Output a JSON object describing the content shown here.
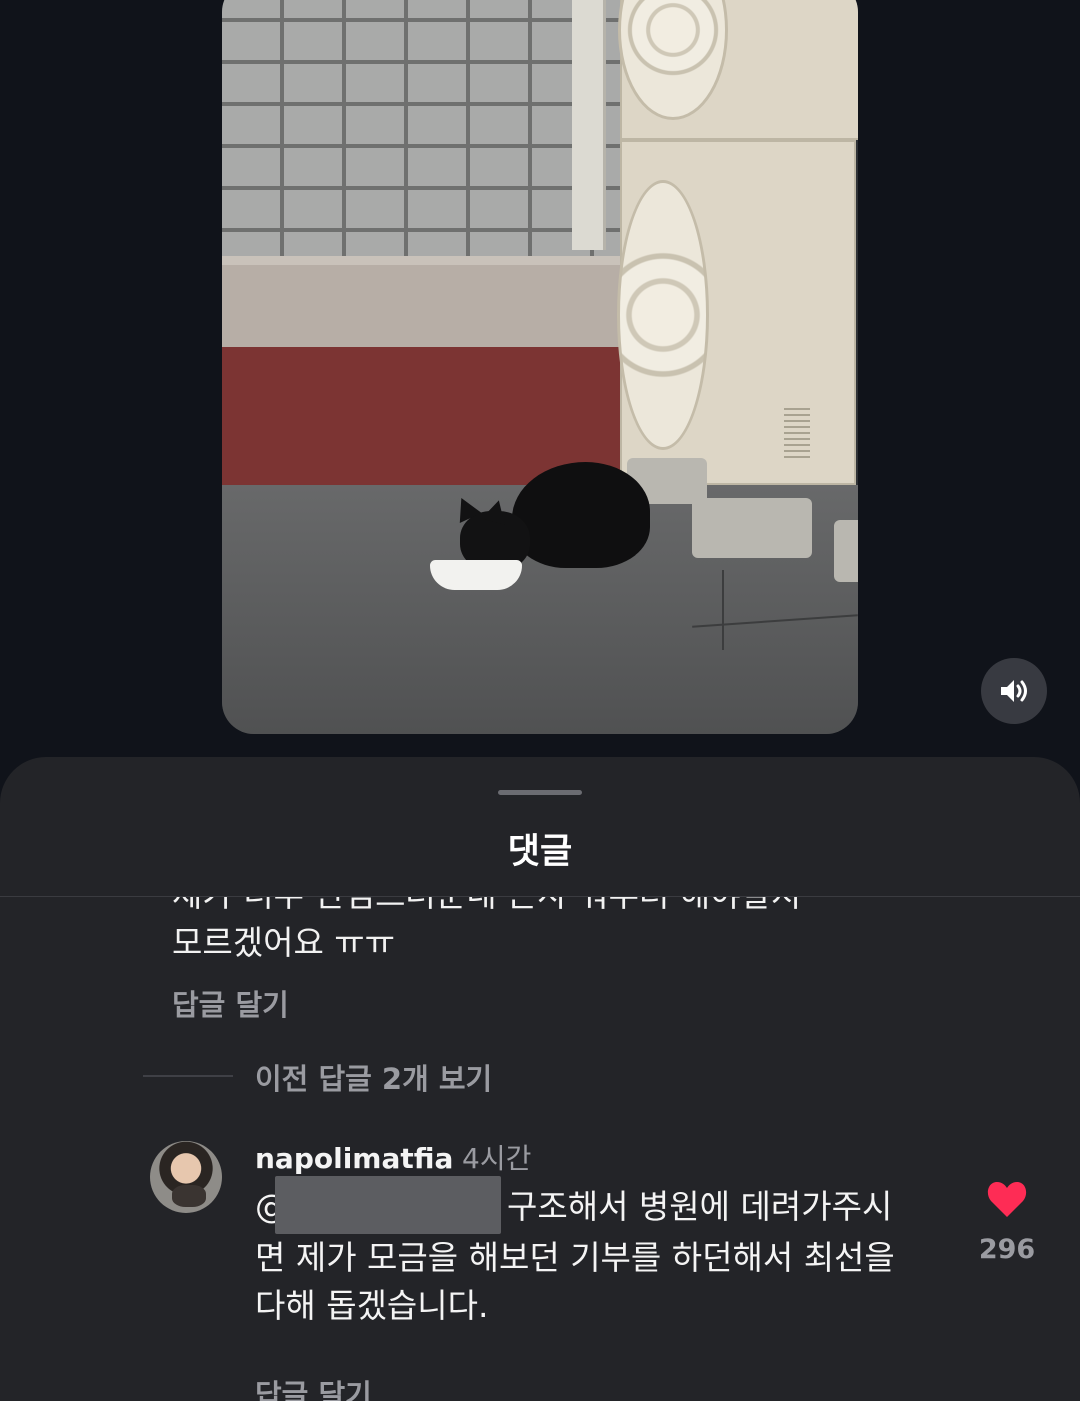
{
  "video": {
    "sound_icon": "speaker-volume-icon"
  },
  "comments_sheet": {
    "title": "댓글",
    "previous_comment": {
      "text_visible": "제가 너무 안심스러운네 온사 뭐부터 해야알지\n모르겠어요 ㅠㅠ",
      "reply_label": "답글 달기"
    },
    "view_previous_replies": "이전 답글 2개 보기",
    "reply": {
      "username": "napolimatfia",
      "time": "4시간",
      "mention_prefix": "@",
      "text": "구조해서 병원에 데려가주시면 제가 모금을 해보던 기부를 하던해서 최선을 다해 돕겠습니다.",
      "reply_label": "답글 달기",
      "like_icon": "heart-filled-icon",
      "like_count": "296",
      "like_color": "#fe2c55"
    }
  }
}
